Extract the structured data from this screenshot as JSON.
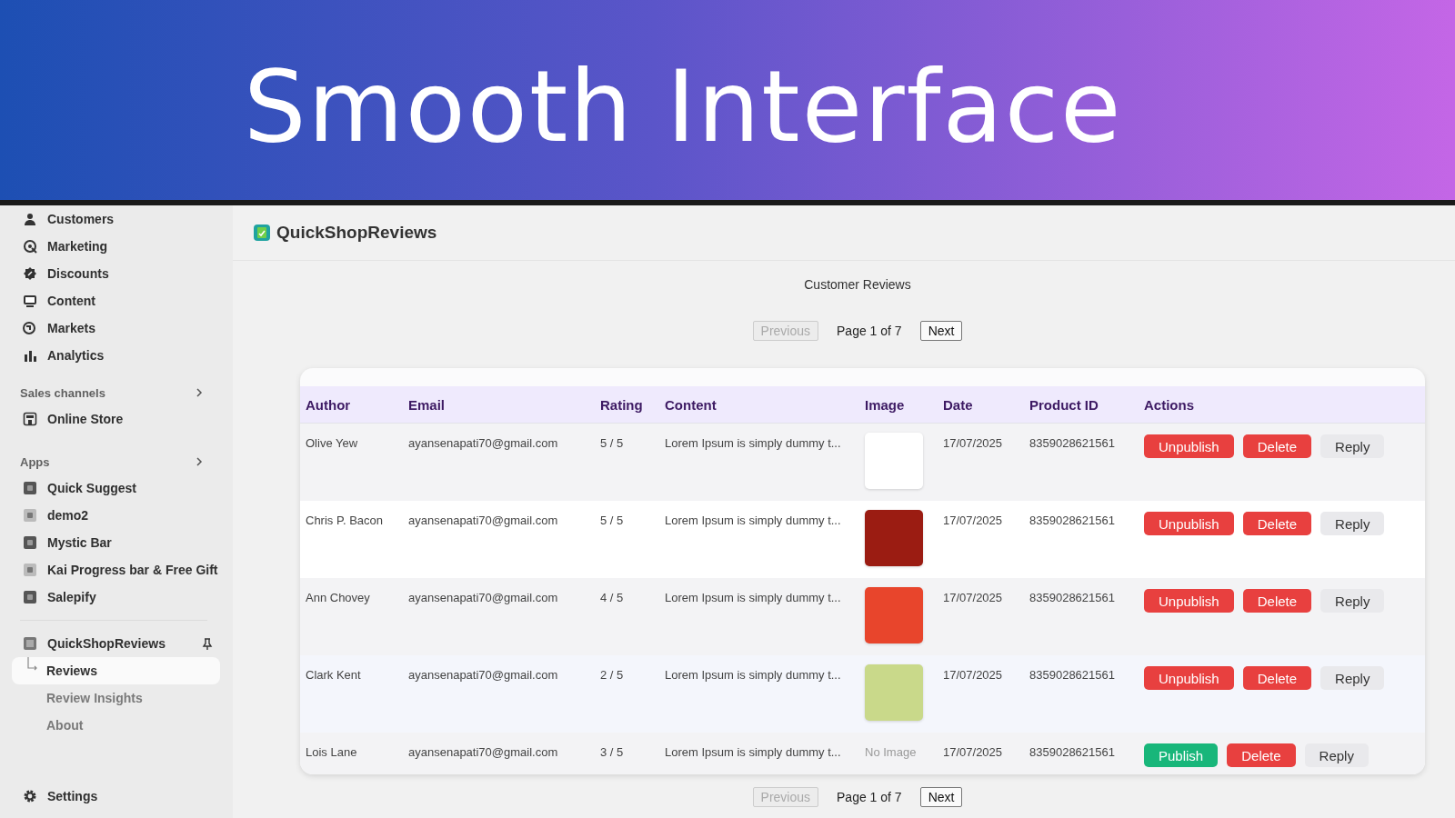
{
  "banner": {
    "title": "Smooth Interface"
  },
  "sidebar": {
    "items": [
      {
        "label": "Customers",
        "kind": "person"
      },
      {
        "label": "Marketing",
        "kind": "target"
      },
      {
        "label": "Discounts",
        "kind": "badge"
      },
      {
        "label": "Content",
        "kind": "monitor"
      },
      {
        "label": "Markets",
        "kind": "globe"
      },
      {
        "label": "Analytics",
        "kind": "bars"
      }
    ],
    "sections": [
      {
        "title": "Sales channels",
        "items": [
          {
            "label": "Online Store",
            "kind": "store"
          }
        ]
      },
      {
        "title": "Apps",
        "items": [
          {
            "label": "Quick Suggest",
            "kind": "app"
          },
          {
            "label": "demo2",
            "kind": "applight"
          },
          {
            "label": "Mystic Bar",
            "kind": "app"
          },
          {
            "label": "Kai Progress bar & Free Gift",
            "kind": "applight"
          },
          {
            "label": "Salepify",
            "kind": "app"
          }
        ]
      }
    ],
    "pinned_app": {
      "label": "QuickShopReviews",
      "children": [
        {
          "label": "Reviews",
          "selected": true
        },
        {
          "label": "Review Insights",
          "selected": false
        },
        {
          "label": "About",
          "selected": false
        }
      ]
    },
    "settings": "Settings"
  },
  "app_header": {
    "title": "QuickShopReviews"
  },
  "page_title": "Customer Reviews",
  "pagination_top": {
    "previous": {
      "label": "Previous",
      "disabled": true
    },
    "page": "Page 1 of 7",
    "next": {
      "label": "Next",
      "disabled": false
    }
  },
  "table": {
    "columns": [
      "Author",
      "Email",
      "Rating",
      "Content",
      "Image",
      "Date",
      "Product ID",
      "Actions"
    ],
    "rows": [
      {
        "author": "Olive Yew",
        "email": "ayansenapati70@gmail.com",
        "rating": "5 / 5",
        "content": "Lorem Ipsum is simply dummy t...",
        "image": {
          "kind": "photo"
        },
        "date": "17/07/2025",
        "product_id": "8359028621561",
        "actions": [
          {
            "label": "Unpublish",
            "kind": "unpublish"
          },
          {
            "label": "Delete",
            "kind": "delete"
          },
          {
            "label": "Reply",
            "kind": "reply"
          }
        ]
      },
      {
        "author": "Chris P. Bacon",
        "email": "ayansenapati70@gmail.com",
        "rating": "5 / 5",
        "content": "Lorem Ipsum is simply dummy t...",
        "image": {
          "kind": "photo"
        },
        "date": "17/07/2025",
        "product_id": "8359028621561",
        "actions": [
          {
            "label": "Unpublish",
            "kind": "unpublish"
          },
          {
            "label": "Delete",
            "kind": "delete"
          },
          {
            "label": "Reply",
            "kind": "reply"
          }
        ]
      },
      {
        "author": "Ann Chovey",
        "email": "ayansenapati70@gmail.com",
        "rating": "4 / 5",
        "content": "Lorem Ipsum is simply dummy t...",
        "image": {
          "kind": "photo"
        },
        "date": "17/07/2025",
        "product_id": "8359028621561",
        "actions": [
          {
            "label": "Unpublish",
            "kind": "unpublish"
          },
          {
            "label": "Delete",
            "kind": "delete"
          },
          {
            "label": "Reply",
            "kind": "reply"
          }
        ]
      },
      {
        "author": "Clark Kent",
        "email": "ayansenapati70@gmail.com",
        "rating": "2 / 5",
        "content": "Lorem Ipsum is simply dummy t...",
        "image": {
          "kind": "photo"
        },
        "date": "17/07/2025",
        "product_id": "8359028621561",
        "actions": [
          {
            "label": "Unpublish",
            "kind": "unpublish"
          },
          {
            "label": "Delete",
            "kind": "delete"
          },
          {
            "label": "Reply",
            "kind": "reply"
          }
        ]
      },
      {
        "author": "Lois Lane",
        "email": "ayansenapati70@gmail.com",
        "rating": "3 / 5",
        "content": "Lorem Ipsum is simply dummy t...",
        "image": {
          "kind": "none",
          "text": "No Image"
        },
        "date": "17/07/2025",
        "product_id": "8359028621561",
        "actions": [
          {
            "label": "Publish",
            "kind": "publish"
          },
          {
            "label": "Delete",
            "kind": "delete"
          },
          {
            "label": "Reply",
            "kind": "reply"
          }
        ]
      }
    ]
  },
  "pagination_bottom": {
    "previous": {
      "label": "Previous",
      "disabled": true
    },
    "page": "Page 1 of 7",
    "next": {
      "label": "Next",
      "disabled": false
    }
  }
}
